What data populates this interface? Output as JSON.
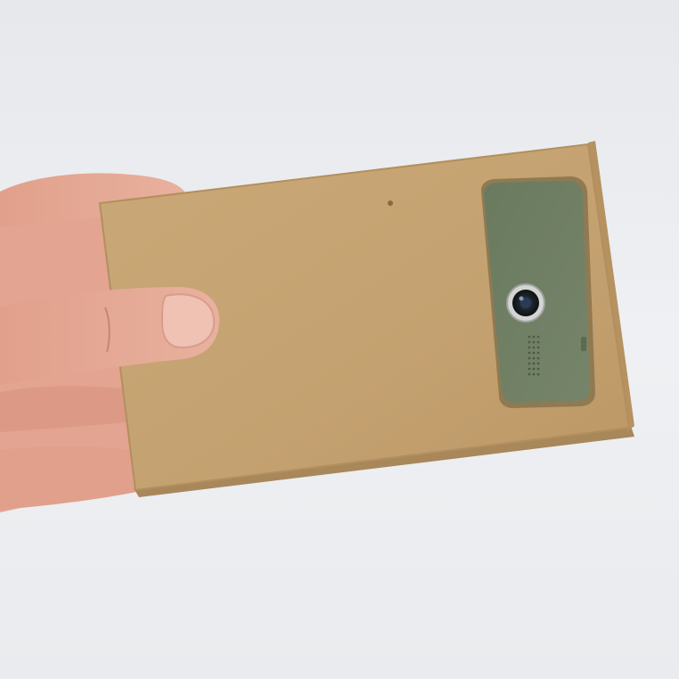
{
  "scene": {
    "description_tags": [
      "hand",
      "cardboard-box",
      "phone-camera-window"
    ],
    "colors": {
      "background": "#ecedf0",
      "cardboard": "#c6a472",
      "cardboard_edge": "#b08d5c",
      "phone_back": "#6f7e63",
      "skin": "#e5a894",
      "lens_ring": "#c9cbc8"
    }
  }
}
